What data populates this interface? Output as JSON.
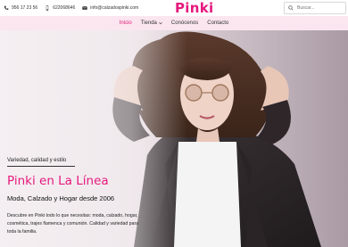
{
  "topbar": {
    "phone1": "956 17 23 56",
    "phone2": "622068646",
    "email": "info@calzadospinki.com"
  },
  "logo": {
    "text": "Pinki"
  },
  "search": {
    "placeholder": "Buscar..."
  },
  "nav": {
    "items": [
      {
        "label": "Inicio"
      },
      {
        "label": "Tienda"
      },
      {
        "label": "Conócenos"
      },
      {
        "label": "Contacto"
      }
    ]
  },
  "hero": {
    "kicker": "Variedad, calidad y estilo",
    "title": "Pinki en La Línea",
    "subtitle": "Moda, Calzado y Hogar desde 2006",
    "description": "Descubre en Pinki todo lo que necesitas: moda, calzado, hogar, cosmética, trajes flamenca y comunión. Calidad y variedad para toda la familia."
  },
  "colors": {
    "brand": "#e5197d",
    "nav_bg": "#fbe6ef"
  }
}
